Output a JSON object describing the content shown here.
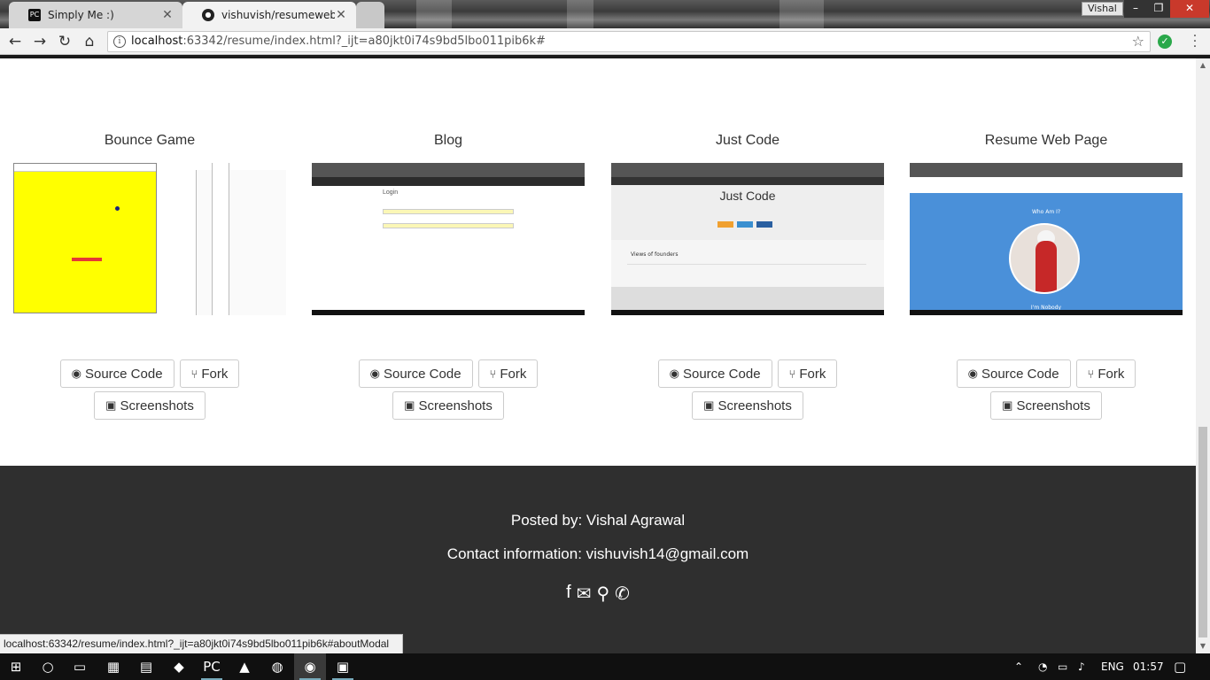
{
  "browser": {
    "tabs": [
      {
        "title": "Simply Me :)",
        "favicon": "pc-icon"
      },
      {
        "title": "vishuvish/resumewebsite",
        "favicon": "github-icon"
      }
    ],
    "profile": "Vishal",
    "url_host": "localhost",
    "url_rest": ":63342/resume/index.html?_ijt=a80jkt0i74s9bd5lbo011pib6k#"
  },
  "projects": [
    {
      "title": "Bounce Game",
      "source_label": "Source Code",
      "fork_label": "Fork",
      "screens_label": "Screenshots"
    },
    {
      "title": "Blog",
      "source_label": "Source Code",
      "fork_label": "Fork",
      "screens_label": "Screenshots"
    },
    {
      "title": "Just Code",
      "source_label": "Source Code",
      "fork_label": "Fork",
      "screens_label": "Screenshots"
    },
    {
      "title": "Resume Web Page",
      "source_label": "Source Code",
      "fork_label": "Fork",
      "screens_label": "Screenshots"
    }
  ],
  "thumbs": {
    "blog_heading": "Login",
    "justcode_heading": "Just Code",
    "justcode_views": "Views of founders",
    "resume_who": "Who Am I?",
    "resume_nobody": "I'm Nobody"
  },
  "footer": {
    "posted_by": "Posted by: Vishal Agrawal",
    "contact": "Contact information: vishuvish14@gmail.com",
    "icons": [
      "facebook-icon",
      "envelope-icon",
      "map-marker-icon",
      "phone-icon"
    ]
  },
  "status_url": "localhost:63342/resume/index.html?_ijt=a80jkt0i74s9bd5lbo011pib6k#aboutModal",
  "taskbar": {
    "language": "ENG",
    "time": "01:57"
  },
  "colors": {
    "footer_bg": "#2f2f2f",
    "close_button": "#c9392b",
    "bounce_bg": "#ffff00",
    "resume_bg": "#4a90d9"
  }
}
